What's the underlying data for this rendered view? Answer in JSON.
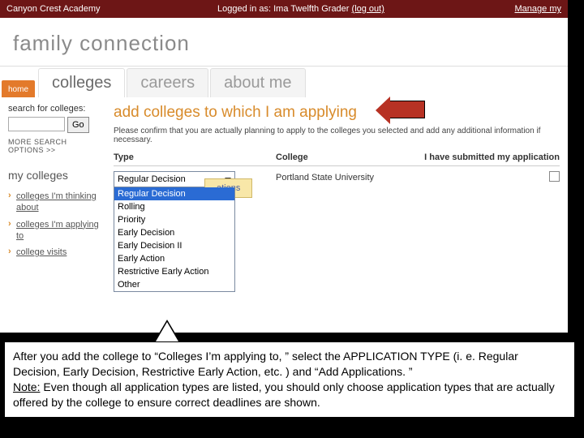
{
  "topbar": {
    "school": "Canyon Crest Academy",
    "logged_prefix": "Logged in as: ",
    "user": "Ima Twelfth Grader",
    "logout": "(log out)",
    "manage": "Manage my"
  },
  "brand": {
    "title": "family connection"
  },
  "tabs": {
    "home": "home",
    "colleges": "colleges",
    "careers": "careers",
    "about": "about me"
  },
  "sidebar": {
    "search_label": "search for colleges:",
    "go": "Go",
    "more": "MORE SEARCH OPTIONS >>",
    "heading": "my colleges",
    "items": [
      "colleges I'm thinking about",
      "colleges I'm applying to",
      "college visits"
    ]
  },
  "main": {
    "title": "add colleges to which I am applying",
    "instruction": "Please confirm that you are actually planning to apply to the colleges you selected and add any additional information if necessary.",
    "columns": {
      "type": "Type",
      "college": "College",
      "submitted": "I have submitted my application"
    },
    "row": {
      "college": "Portland State University"
    },
    "dropdown": {
      "selected": "Regular Decision",
      "options": [
        "Regular Decision",
        "Rolling",
        "Priority",
        "Early Decision",
        "Early Decision II",
        "Early Action",
        "Restrictive Early Action",
        "Other"
      ]
    },
    "ations_btn": "ations"
  },
  "caption": {
    "line1": "After you add the college to “Colleges I’m applying to, ” select the APPLICATION TYPE (i. e. Regular Decision, Early Decision, Restrictive Early Action, etc. ) and “Add Applications. ”",
    "note_label": "Note:",
    "line2": " Even though all application types are listed, you should only choose application types that are actually offered by the college to ensure correct deadlines are shown."
  }
}
